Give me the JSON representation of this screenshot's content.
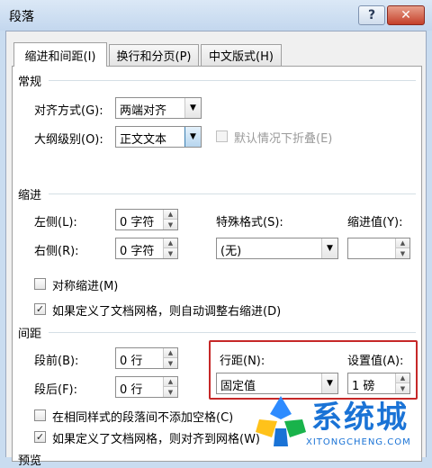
{
  "window": {
    "title": "段落",
    "help": "?",
    "close": "✕"
  },
  "tabs": [
    {
      "label": "缩进和间距(I)",
      "active": true
    },
    {
      "label": "换行和分页(P)",
      "active": false
    },
    {
      "label": "中文版式(H)",
      "active": false
    }
  ],
  "general": {
    "heading": "常规",
    "alignment_label": "对齐方式(G):",
    "alignment_value": "两端对齐",
    "outline_label": "大纲级别(O):",
    "outline_value": "正文文本",
    "collapse_label": "默认情况下折叠(E)"
  },
  "indent": {
    "heading": "缩进",
    "left_label": "左侧(L):",
    "left_value": "0 字符",
    "right_label": "右侧(R):",
    "right_value": "0 字符",
    "special_label": "特殊格式(S):",
    "special_value": "(无)",
    "by_label": "缩进值(Y):",
    "by_value": "",
    "mirror_label": "对称缩进(M)",
    "auto_adjust_label": "如果定义了文档网格，则自动调整右缩进(D)"
  },
  "spacing": {
    "heading": "间距",
    "before_label": "段前(B):",
    "before_value": "0 行",
    "after_label": "段后(F):",
    "after_value": "0 行",
    "line_label": "行距(N):",
    "line_value": "固定值",
    "at_label": "设置值(A):",
    "at_value": "1 磅",
    "no_space_label": "在相同样式的段落间不添加空格(C)",
    "snap_grid_label": "如果定义了文档网格，则对齐到网格(W)"
  },
  "preview": {
    "heading": "预览"
  },
  "checks": {
    "mark": "✓"
  },
  "watermark": {
    "text": "系统城",
    "sub": "XITONGCHENG.COM"
  },
  "icons": {
    "dropdown": "▼",
    "spin_up": "▲",
    "spin_down": "▼"
  },
  "colors": {
    "highlight": "#c62828",
    "watermark": "#1a73d6"
  }
}
